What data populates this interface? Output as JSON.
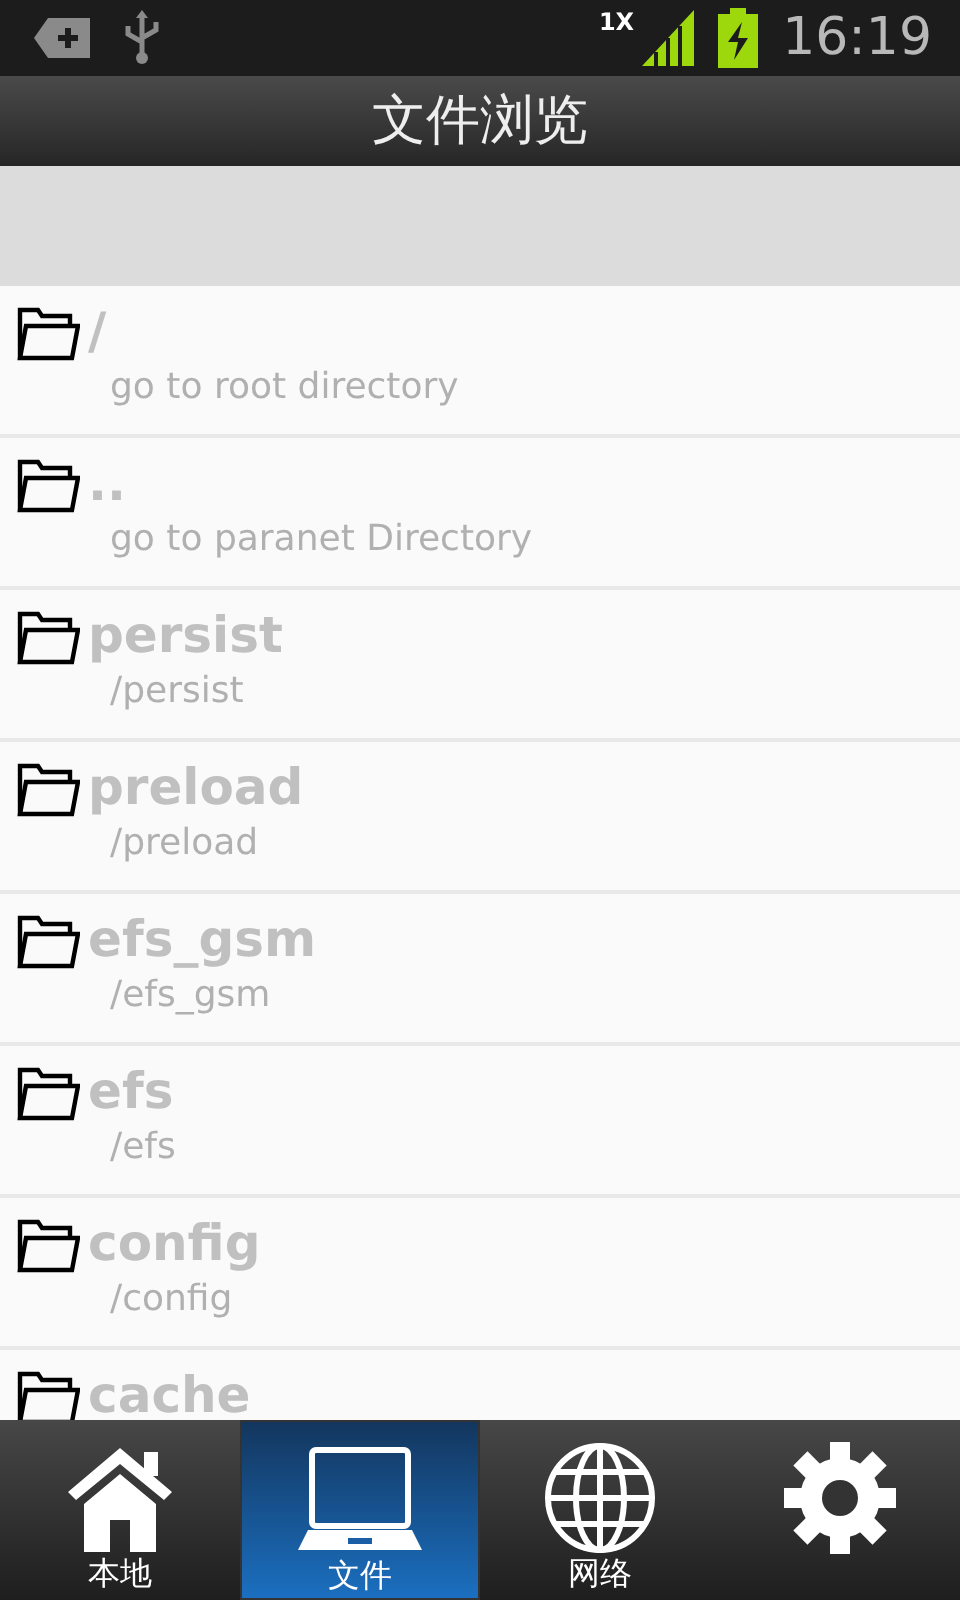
{
  "status_bar": {
    "network": "1X",
    "time": "16:19"
  },
  "title": "文件浏览",
  "entries": [
    {
      "name": "/",
      "detail": "go to root directory"
    },
    {
      "name": "..",
      "detail": "go to paranet Directory"
    },
    {
      "name": "persist",
      "detail": "/persist"
    },
    {
      "name": "preload",
      "detail": "/preload"
    },
    {
      "name": "efs_gsm",
      "detail": "/efs_gsm"
    },
    {
      "name": "efs",
      "detail": "/efs"
    },
    {
      "name": "config",
      "detail": "/config"
    },
    {
      "name": "cache"
    }
  ],
  "tabs": [
    {
      "kind": "home",
      "label": "本地",
      "selected": false
    },
    {
      "kind": "laptop",
      "label": "文件",
      "selected": true
    },
    {
      "kind": "globe",
      "label": "网络",
      "selected": false
    },
    {
      "kind": "gear",
      "selected": false
    }
  ]
}
